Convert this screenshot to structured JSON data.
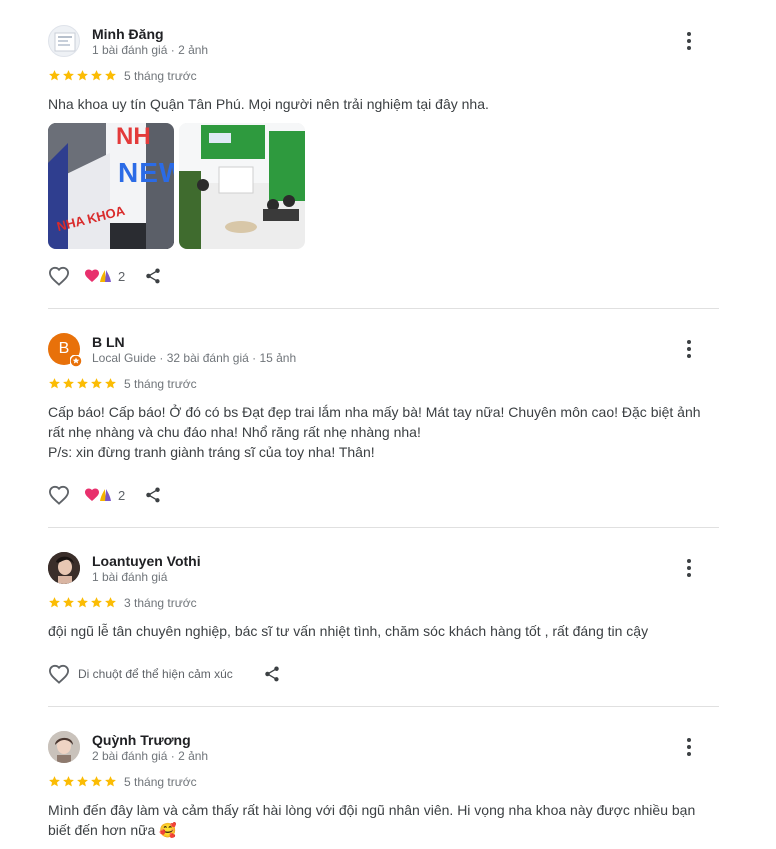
{
  "reviews": [
    {
      "name": "Minh Đăng",
      "meta": "1 bài đánh giá · 2 ảnh",
      "rating": 5,
      "time": "5 tháng trước",
      "text": "Nha khoa uy tín Quận Tân Phú. Mọi người nên trải nghiệm tại đây nha.",
      "reaction_count": "2",
      "photos": [
        {
          "alt": "storefront-sign-new",
          "caption_top": "NH",
          "caption_mid": "NEW",
          "caption_sign": "NHA KHOA"
        },
        {
          "alt": "clinic-interior-reception"
        }
      ]
    },
    {
      "name": "B LN",
      "avatar_letter": "B",
      "avatar_color": "#e8710a",
      "meta": "Local Guide · 32 bài đánh giá · 15 ảnh",
      "rating": 5,
      "time": "5 tháng trước",
      "text_lines": [
        "Cấp báo! Cấp báo! Ở đó có bs Đạt đẹp trai lắm nha mấy bà! Mát tay nữa! Chuyên môn cao! Đặc biệt ảnh",
        "rất nhẹ nhàng và chu đáo nha! Nhổ răng rất nhẹ nhàng nha!",
        "P/s: xin đừng tranh giành tráng sĩ của toy nha! Thân!"
      ],
      "reaction_count": "2"
    },
    {
      "name": "Loantuyen Vothi",
      "meta": "1 bài đánh giá",
      "rating": 5,
      "time": "3 tháng trước",
      "text": "đội ngũ lễ tân chuyên nghiệp, bác sĩ tư vấn nhiệt tình, chăm sóc khách hàng tốt , rất đáng tin cậy",
      "hover_hint": "Di chuột để thể hiện cảm xúc"
    },
    {
      "name": "Quỳnh Trương",
      "meta": "2 bài đánh giá · 2 ảnh",
      "rating": 5,
      "time": "5 tháng trước",
      "text_lines": [
        "Mình đến đây làm và cảm thấy rất hài lòng với đội ngũ nhân viên. Hi vọng nha khoa này được nhiều bạn",
        "biết đến hơn nữa 🥰"
      ]
    }
  ],
  "colors": {
    "star": "#fbbc04",
    "meta": "#70757a",
    "icon": "#5f6368",
    "divider": "#e0e0e0",
    "clinic_green": "#2e9a3e"
  },
  "icons": {
    "like": "heart-outline-icon",
    "share": "share-icon",
    "menu": "more-vert-icon",
    "reactions": "heart-and-pray-reaction-icon"
  }
}
